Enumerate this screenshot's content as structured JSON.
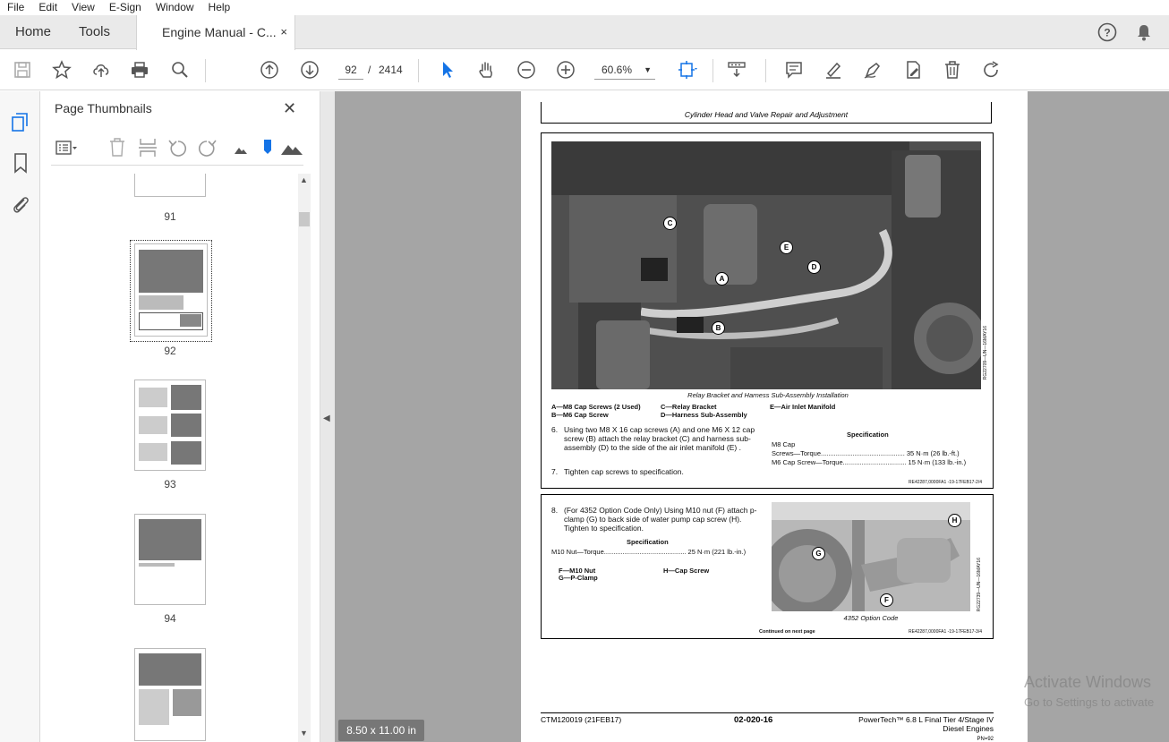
{
  "menu": [
    "File",
    "Edit",
    "View",
    "E-Sign",
    "Window",
    "Help"
  ],
  "tabs": {
    "home": "Home",
    "tools": "Tools",
    "doc": "Engine Manual - C...",
    "close": "×"
  },
  "toolbar": {
    "page_current": "92",
    "page_sep": "/",
    "page_total": "2414",
    "zoom": "60.6%"
  },
  "panel": {
    "title": "Page Thumbnails",
    "thumbnails": [
      {
        "label": "91"
      },
      {
        "label": "92"
      },
      {
        "label": "93"
      },
      {
        "label": "94"
      }
    ]
  },
  "status": {
    "page_size": "8.50 x 11.00 in"
  },
  "watermark": {
    "line1": "Activate Windows",
    "line2": "Go to Settings to activate"
  },
  "doc": {
    "header": "Cylinder Head and Valve Repair and Adjustment",
    "fig1_caption": "Relay Bracket and Harness Sub-Assembly Installation",
    "fig1_id": "RG22709—UN—16MAY16",
    "callouts": [
      "C",
      "A",
      "E",
      "D",
      "B"
    ],
    "legend1": [
      "A—M8 Cap Screws (2 Used)",
      "B—M6 Cap Screw",
      "C—Relay Bracket",
      "D—Harness Sub-Assembly",
      "E—Air Inlet Manifold"
    ],
    "step6_num": "6.",
    "step6": "Using two M8 X 16 cap screws (A) and one M6 X 12 cap screw (B) attach the relay bracket (C) and harness sub-assembly (D) to the side of the air inlet manifold (E) .",
    "step7_num": "7.",
    "step7": "Tighten cap screws to specification.",
    "spec_title": "Specification",
    "spec1_a": "M8  Cap",
    "spec1_b": "Screws—Torque............................................. 35 N·m (26 lb.-ft.)",
    "spec2": "M6 Cap Screw—Torque.................................. 15 N·m (133 lb.-in.)",
    "ref1": "RE42287,0000FA1 -19-17FEB17-2/4",
    "step8_num": "8.",
    "step8": "(For 4352 Option Code Only) Using M10 nut (F) attach p-clamp (G) to back side of water pump cap screw (H). Tighten to specification.",
    "spec3_title": "Specification",
    "spec3": "M10 Nut—Torque............................................ 25 N·m (221 lb.-in.)",
    "legend2": [
      "F—M10 Nut",
      "G—P-Clamp",
      "H—Cap Screw"
    ],
    "callouts2": [
      "H",
      "G",
      "F"
    ],
    "fig2_caption": "4352  Option  Code",
    "fig2_id": "RG22739—UN—16MAY16",
    "continued": "Continued on next page",
    "ref2": "RE42287,0000FA1 -19-17FEB17-3/4",
    "footer_left": "CTM120019 (21FEB17)",
    "footer_mid": "02-020-16",
    "footer_right1": "PowerTech™ 6.8 L Final Tier 4/Stage IV",
    "footer_right2": "Diesel Engines",
    "footer_tiny": "PN=92"
  },
  "colors": {
    "accent": "#1473e6",
    "chrome": "#eaeaea",
    "docbg": "#a5a5a5"
  }
}
